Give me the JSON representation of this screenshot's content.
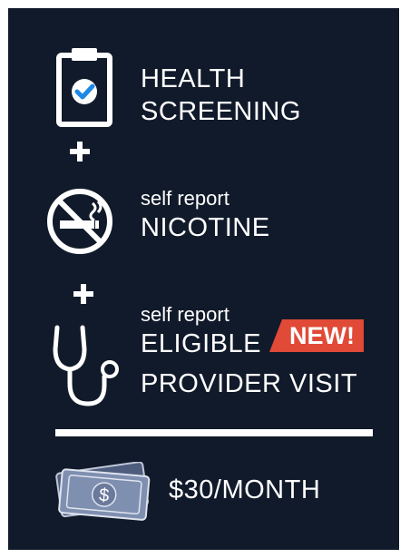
{
  "items": {
    "health": {
      "line1": "HEALTH",
      "line2": "SCREENING"
    },
    "nicotine": {
      "prefix": "self report",
      "title": "NICOTINE"
    },
    "provider": {
      "prefix": "self report",
      "line1": "ELIGIBLE",
      "line2": "PROVIDER VISIT",
      "badge": "NEW!"
    }
  },
  "reward": {
    "amount": "$30/MONTH",
    "currency_symbol": "$"
  },
  "colors": {
    "background": "#111a2a",
    "accent_red": "#e04a37",
    "check_blue": "#1e88e5",
    "money_blue": "#7f8fb0"
  },
  "icons": {
    "clipboard": "clipboard-check-icon",
    "no_smoking": "no-smoking-icon",
    "stethoscope": "stethoscope-icon",
    "money": "money-bills-icon",
    "plus": "plus-icon"
  }
}
